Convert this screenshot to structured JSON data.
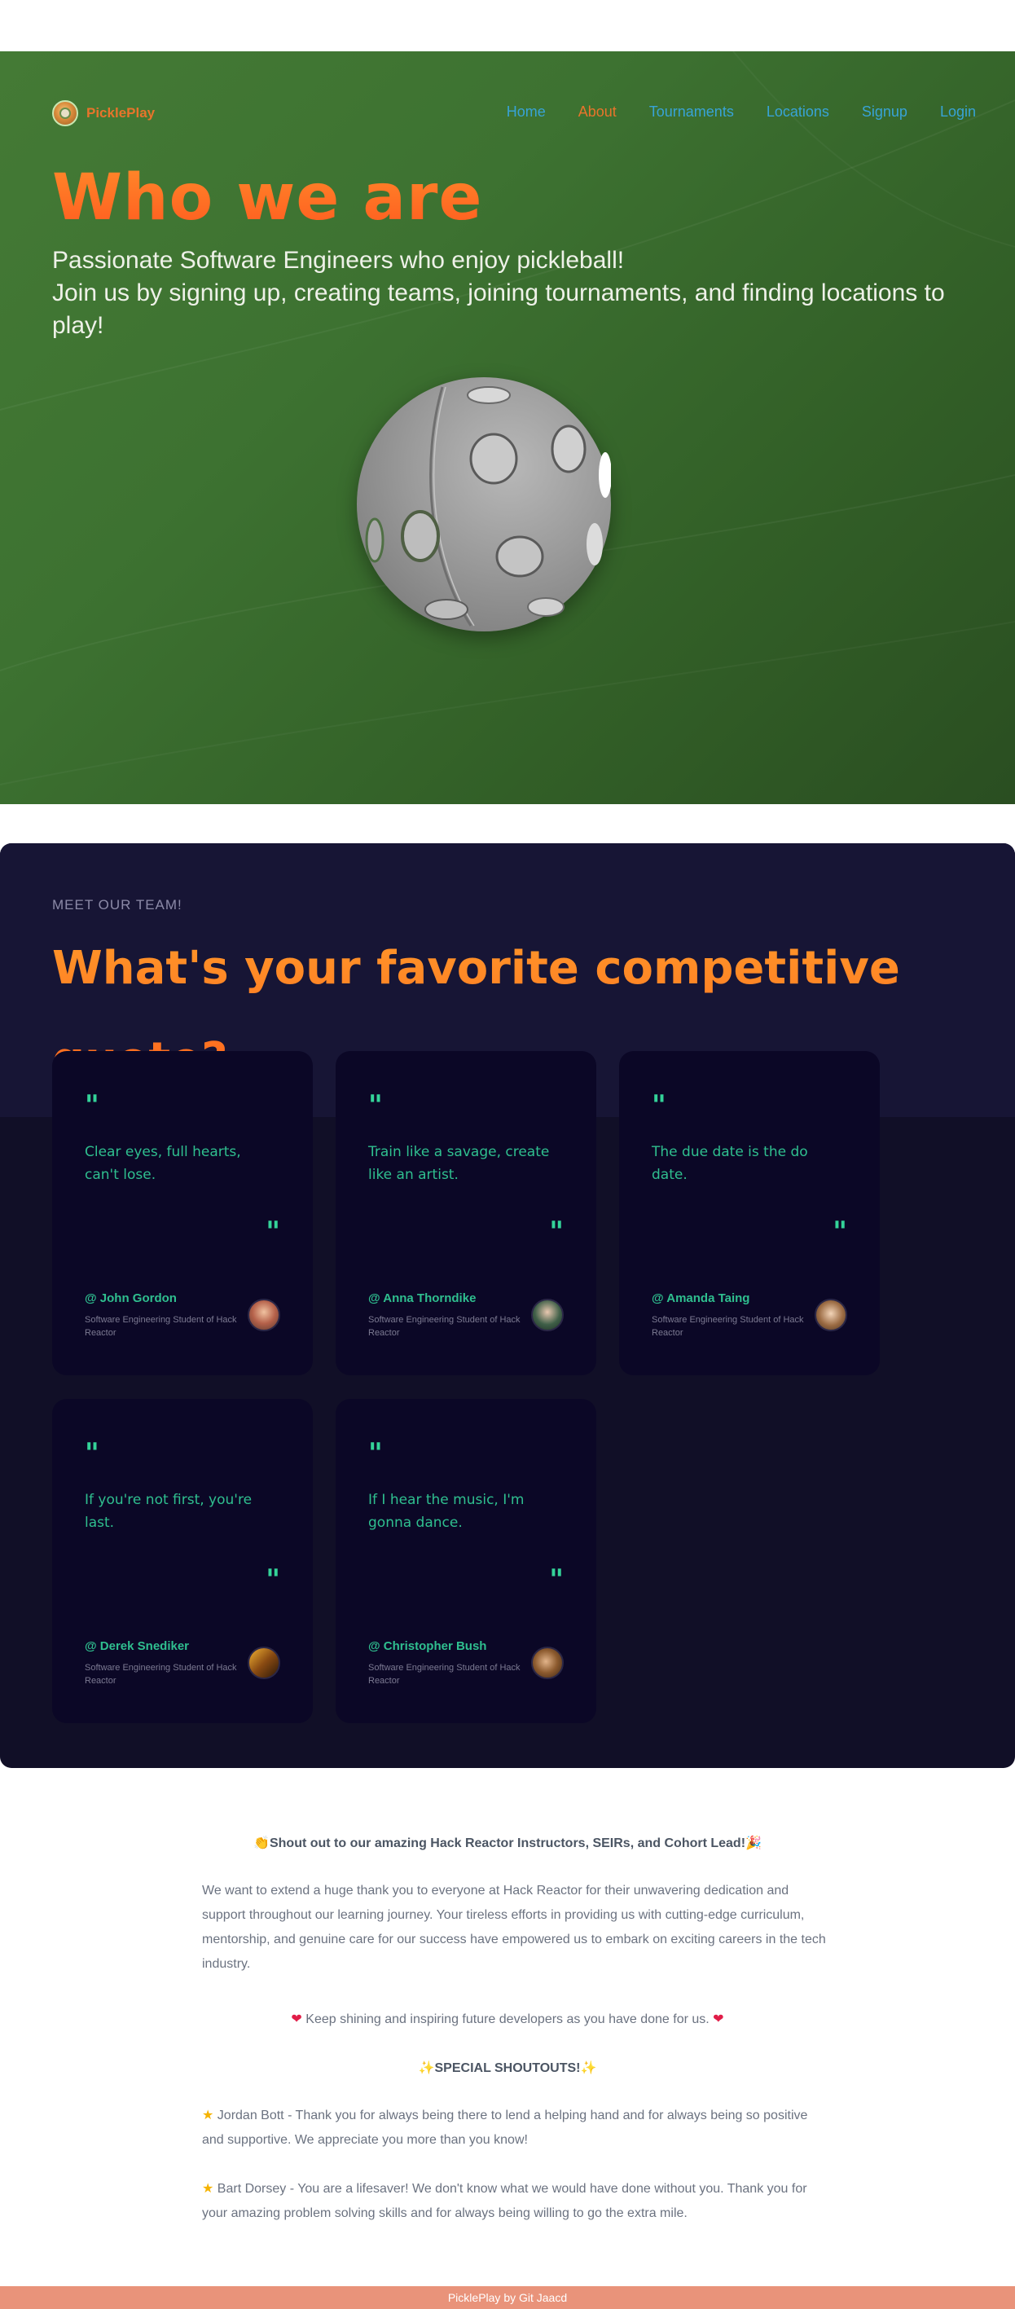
{
  "nav": {
    "brand": "PicklePlay",
    "links": [
      "Home",
      "About",
      "Tournaments",
      "Locations",
      "Signup",
      "Login"
    ],
    "active": "About"
  },
  "hero": {
    "title": "Who we are",
    "line1": "Passionate Software Engineers who enjoy pickleball!",
    "line2": "Join us by signing up, creating teams, joining tournaments, and finding locations to play!"
  },
  "team": {
    "eyebrow": "MEET OUR TEAM!",
    "heading": "What's your favorite competitive quote?",
    "quote_mark": "\"",
    "members": [
      {
        "quote": "Clear eyes, full hearts, can't lose.",
        "name": "@ John Gordon",
        "role": "Software Engineering Student of Hack Reactor"
      },
      {
        "quote": "Train like a savage, create like an artist.",
        "name": "@ Anna Thorndike",
        "role": "Software Engineering Student of Hack Reactor"
      },
      {
        "quote": "The due date is the do date.",
        "name": "@ Amanda Taing",
        "role": "Software Engineering Student of Hack Reactor"
      },
      {
        "quote": "If you're not first, you're last.",
        "name": "@ Derek Snediker",
        "role": "Software Engineering Student of Hack Reactor"
      },
      {
        "quote": "If I hear the music, I'm gonna dance.",
        "name": "@ Christopher Bush",
        "role": "Software Engineering Student of Hack Reactor"
      }
    ]
  },
  "thanks": {
    "heading": "Shout out to our amazing Hack Reactor Instructors, SEIRs, and Cohort Lead!",
    "paragraph": "We want to extend a huge thank you to everyone at Hack Reactor for their unwavering dedication and support throughout our learning journey. Your tireless efforts in providing us with cutting-edge curriculum, mentorship, and genuine care for our success have empowered us to embark on exciting careers in the tech industry.",
    "keep_shining": "Keep shining and inspiring future developers as you have done for us.",
    "special_heading": "SPECIAL SHOUTOUTS!",
    "shoutout1": "Jordan Bott - Thank you for always being there to lend a helping hand and for always being so positive and supportive. We appreciate you more than you know!",
    "shoutout2": "Bart Dorsey - You are a lifesaver! We don't know what we would have done without you. Thank you for your amazing problem solving skills and for always being willing to go the extra mile."
  },
  "footer": {
    "text": "PicklePlay by Git Jaacd"
  },
  "icons": {
    "logo": "pickleball-logo-icon",
    "clap": "clapping-hands-icon",
    "party": "party-popper-icon",
    "heart": "red-heart-icon",
    "sparkles": "sparkles-icon",
    "star": "star-icon"
  },
  "colors": {
    "accent_orange": "#e8742b",
    "link_blue": "#38a3d6",
    "quote_green": "#2fbf8f",
    "hero_green": "#3d7231",
    "team_bg": "#110f27",
    "footer_bg": "#e9937a"
  }
}
